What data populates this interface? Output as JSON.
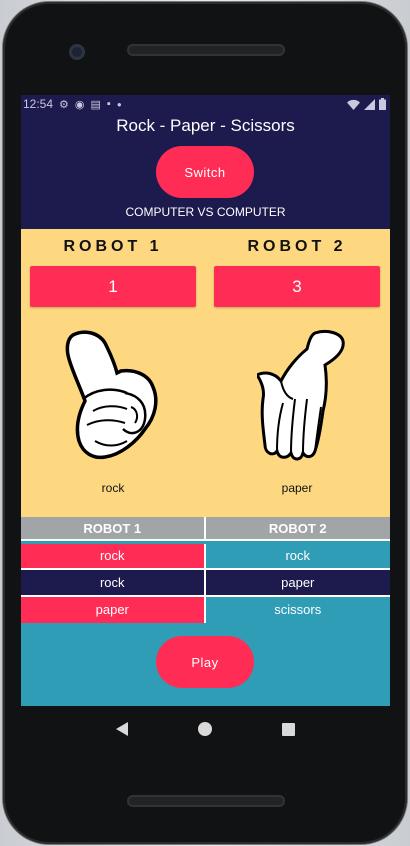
{
  "status_bar": {
    "time": "12:54",
    "left_icons": [
      "gear-icon",
      "shield-icon",
      "news-icon",
      "sim-icon",
      "dot-icon"
    ],
    "right_icons": [
      "wifi-icon",
      "signal-icon",
      "battery-icon"
    ]
  },
  "header": {
    "title": "Rock - Paper - Scissors",
    "switch_label": "Switch",
    "mode_label": "COMPUTER VS COMPUTER"
  },
  "players": [
    {
      "name": "ROBOT 1",
      "score": "1",
      "choice": "rock",
      "hand_icon": "rock-fist-icon"
    },
    {
      "name": "ROBOT 2",
      "score": "3",
      "choice": "paper",
      "hand_icon": "paper-hand-icon"
    }
  ],
  "history": {
    "headers": [
      "ROBOT 1",
      "ROBOT 2"
    ],
    "rows": [
      [
        "rock",
        "rock"
      ],
      [
        "rock",
        "paper"
      ],
      [
        "paper",
        "scissors"
      ]
    ]
  },
  "play_label": "Play",
  "colors": {
    "navy": "#1d1a4e",
    "pink": "#ff2d55",
    "yellow": "#fdd880",
    "teal": "#2f9db5",
    "grey": "#a2a5a7"
  },
  "navigation": [
    "back-icon",
    "home-icon",
    "recent-apps-icon"
  ]
}
